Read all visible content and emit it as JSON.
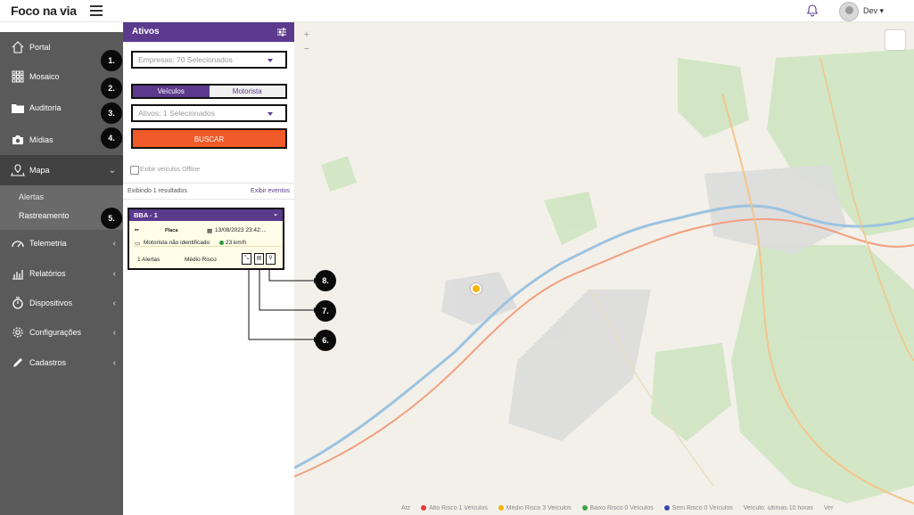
{
  "header": {
    "logo": "Foco na via",
    "user": "Dev"
  },
  "sidebar": {
    "items": [
      {
        "label": "Portal"
      },
      {
        "label": "Mosaico"
      },
      {
        "label": "Auditoria"
      },
      {
        "label": "Mídias"
      },
      {
        "label": "Mapa"
      },
      {
        "label": "Telemetria"
      },
      {
        "label": "Relatórios"
      },
      {
        "label": "Dispositivos"
      },
      {
        "label": "Configurações"
      },
      {
        "label": "Cadastros"
      }
    ],
    "submenu": [
      "Alertas",
      "Rastreamento"
    ]
  },
  "panel": {
    "title": "Ativos",
    "empresas": "Empresas: 70 Selecionados",
    "tabs": [
      "Veículos",
      "Motorista"
    ],
    "ativos": "Ativos: 1 Selecionados",
    "buscar": "BUSCAR",
    "offline_label": "Exibir veículos Offline",
    "results": "Exibindo 1 resultados",
    "events": "Exibir eventos"
  },
  "card": {
    "title": "BBA - 1",
    "plate": "Placa",
    "datetime": "13/08/2023 23:42:...",
    "driver": "Motorista não identificado",
    "speed": "23 km/h",
    "alerts": "1 Alertas",
    "risk": "Médio Risco"
  },
  "legend": [
    {
      "text": "Alto Risco 1 Veículos",
      "color": "#e53935"
    },
    {
      "text": "Médio Risco 3 Veículos",
      "color": "#f4b400"
    },
    {
      "text": "Baixo Risco 0 Veículos",
      "color": "#43a047"
    },
    {
      "text": "Sem Risco 0 Veículos",
      "color": "#3949ab"
    },
    {
      "text": "Veículo: últimas 10 horas",
      "color": ""
    }
  ],
  "legend_prefix": "Atz",
  "legend_suffix": "Ver",
  "callouts": [
    "1.",
    "2.",
    "3.",
    "4.",
    "5.",
    "6.",
    "7.",
    "8."
  ],
  "colors": {
    "brand": "#5b3a8e",
    "accent": "#f05a28",
    "sidebar": "#5a5a5a"
  }
}
